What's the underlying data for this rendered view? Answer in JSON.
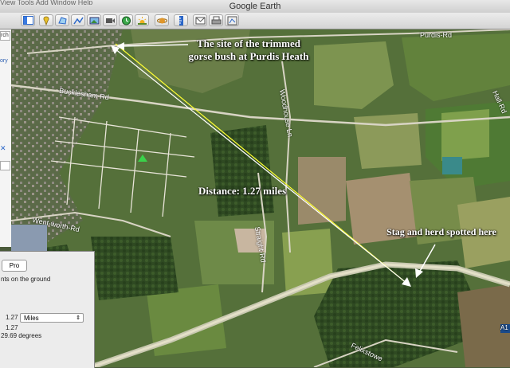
{
  "window": {
    "title": "Google Earth",
    "menu_fragment": "View  Tools  Add  Window  Help"
  },
  "toolbar": {
    "buttons": [
      {
        "icon": "sidebar-toggle-icon"
      },
      {
        "icon": "placemark-icon"
      },
      {
        "icon": "polygon-icon"
      },
      {
        "icon": "path-icon"
      },
      {
        "icon": "image-overlay-icon"
      },
      {
        "icon": "record-tour-icon"
      },
      {
        "icon": "historical-imagery-icon"
      },
      {
        "icon": "sunlight-icon"
      },
      {
        "icon": "planets-icon"
      },
      {
        "icon": "ruler-icon"
      },
      {
        "icon": "email-icon"
      },
      {
        "icon": "print-icon"
      },
      {
        "icon": "view-in-maps-icon"
      }
    ]
  },
  "left_panel": {
    "search_fragment": "rch",
    "history_fragment": "ory",
    "close_glyph": "✕"
  },
  "ruler_dialog": {
    "tab_pro": "Pro",
    "instructions": "nts on the ground",
    "length_value": "1.27",
    "units_selected": "Miles",
    "ground_length": "1.27",
    "heading": "29.69 degrees"
  },
  "map": {
    "annotations": {
      "site_label": "The site of the trimmed gorse bush at Purdis Heath",
      "distance_label": "Distance: 1.27 miles",
      "stag_label": "Stag and herd spotted here"
    },
    "road_labels": {
      "purdis_rd": "Purdis-Rd",
      "bucklesham_rd": "Bucklesham Rd",
      "woodhouse_ln": "Woodhouse Ln",
      "straight_rd": "Straight-Rd",
      "hall_rd": "Hall-Rd",
      "wentworth_rd": "Went-worth-Rd",
      "felixstowe": "Felixstowe",
      "a14": "A1"
    },
    "colors": {
      "ruler_line": "#ffff33",
      "arrows": "#ffffff"
    }
  }
}
